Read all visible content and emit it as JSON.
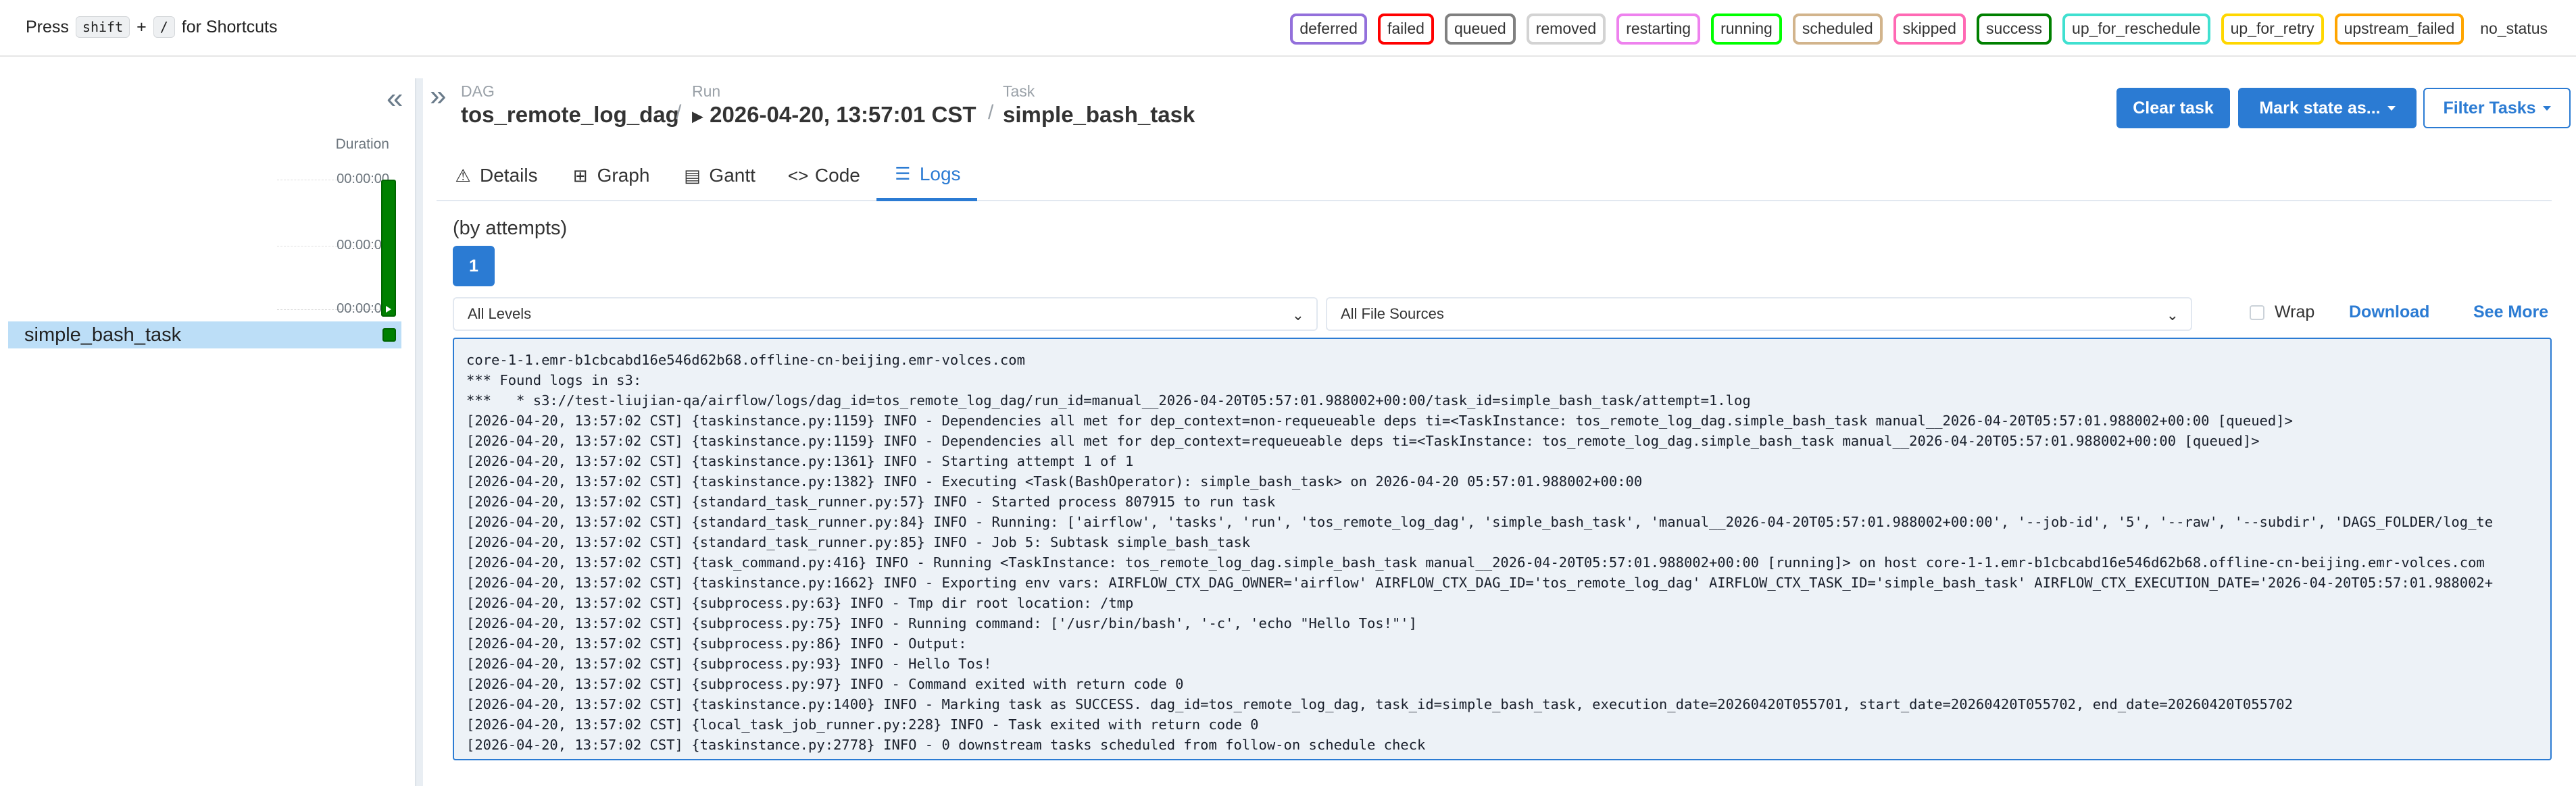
{
  "topbar": {
    "shortcut_prefix": "Press",
    "shortcut_key1": "shift",
    "shortcut_plus": "+",
    "shortcut_key2": "/",
    "shortcut_suffix": "for Shortcuts",
    "states": [
      {
        "label": "deferred",
        "color": "#9370DB"
      },
      {
        "label": "failed",
        "color": "#FF0000"
      },
      {
        "label": "queued",
        "color": "#808080"
      },
      {
        "label": "removed",
        "color": "#D3D3D3"
      },
      {
        "label": "restarting",
        "color": "#EE82EE"
      },
      {
        "label": "running",
        "color": "#00FF00"
      },
      {
        "label": "scheduled",
        "color": "#D2B48C"
      },
      {
        "label": "skipped",
        "color": "#FF69B4"
      },
      {
        "label": "success",
        "color": "#008000"
      },
      {
        "label": "up_for_reschedule",
        "color": "#40E0D0"
      },
      {
        "label": "up_for_retry",
        "color": "#FFD700"
      },
      {
        "label": "upstream_failed",
        "color": "#FFA500"
      }
    ],
    "no_status": "no_status"
  },
  "grid": {
    "duration_label": "Duration",
    "ticks": [
      "00:00:00",
      "00:00:00",
      "00:00:00"
    ],
    "task_name": "simple_bash_task",
    "run_state_color": "#008000",
    "collapse_icon": "double-chevron-left-icon",
    "expand_icon": "double-chevron-right-icon"
  },
  "header": {
    "dag_label": "DAG",
    "dag_value": "tos_remote_log_dag",
    "run_label": "Run",
    "run_value": "2026-04-20, 13:57:01 CST",
    "task_label": "Task",
    "task_value": "simple_bash_task",
    "separator": "/",
    "clear_task": "Clear task",
    "mark_state": "Mark state as...",
    "filter_tasks": "Filter Tasks"
  },
  "tabs": [
    {
      "label": "Details",
      "icon": "warning-triangle-icon",
      "glyph": "⚠"
    },
    {
      "label": "Graph",
      "icon": "graph-icon",
      "glyph": "⊞"
    },
    {
      "label": "Gantt",
      "icon": "gantt-icon",
      "glyph": "▤"
    },
    {
      "label": "Code",
      "icon": "code-icon",
      "glyph": "<>"
    },
    {
      "label": "Logs",
      "icon": "logs-icon",
      "glyph": "☰"
    }
  ],
  "active_tab": "Logs",
  "logs": {
    "attempts_label": "(by attempts)",
    "attempt": "1",
    "level_filter": "All Levels",
    "source_filter": "All File Sources",
    "wrap_label": "Wrap",
    "download_label": "Download",
    "see_more_label": "See More",
    "lines": [
      "core-1-1.emr-b1cbcabd16e546d62b68.offline-cn-beijing.emr-volces.com",
      "*** Found logs in s3:",
      "***   * s3://test-liujian-qa/airflow/logs/dag_id=tos_remote_log_dag/run_id=manual__2026-04-20T05:57:01.988002+00:00/task_id=simple_bash_task/attempt=1.log",
      "[2026-04-20, 13:57:02 CST] {taskinstance.py:1159} INFO - Dependencies all met for dep_context=non-requeueable deps ti=<TaskInstance: tos_remote_log_dag.simple_bash_task manual__2026-04-20T05:57:01.988002+00:00 [queued]>",
      "[2026-04-20, 13:57:02 CST] {taskinstance.py:1159} INFO - Dependencies all met for dep_context=requeueable deps ti=<TaskInstance: tos_remote_log_dag.simple_bash_task manual__2026-04-20T05:57:01.988002+00:00 [queued]>",
      "[2026-04-20, 13:57:02 CST] {taskinstance.py:1361} INFO - Starting attempt 1 of 1",
      "[2026-04-20, 13:57:02 CST] {taskinstance.py:1382} INFO - Executing <Task(BashOperator): simple_bash_task> on 2026-04-20 05:57:01.988002+00:00",
      "[2026-04-20, 13:57:02 CST] {standard_task_runner.py:57} INFO - Started process 807915 to run task",
      "[2026-04-20, 13:57:02 CST] {standard_task_runner.py:84} INFO - Running: ['airflow', 'tasks', 'run', 'tos_remote_log_dag', 'simple_bash_task', 'manual__2026-04-20T05:57:01.988002+00:00', '--job-id', '5', '--raw', '--subdir', 'DAGS_FOLDER/log_te",
      "[2026-04-20, 13:57:02 CST] {standard_task_runner.py:85} INFO - Job 5: Subtask simple_bash_task",
      "[2026-04-20, 13:57:02 CST] {task_command.py:416} INFO - Running <TaskInstance: tos_remote_log_dag.simple_bash_task manual__2026-04-20T05:57:01.988002+00:00 [running]> on host core-1-1.emr-b1cbcabd16e546d62b68.offline-cn-beijing.emr-volces.com",
      "[2026-04-20, 13:57:02 CST] {taskinstance.py:1662} INFO - Exporting env vars: AIRFLOW_CTX_DAG_OWNER='airflow' AIRFLOW_CTX_DAG_ID='tos_remote_log_dag' AIRFLOW_CTX_TASK_ID='simple_bash_task' AIRFLOW_CTX_EXECUTION_DATE='2026-04-20T05:57:01.988002+",
      "[2026-04-20, 13:57:02 CST] {subprocess.py:63} INFO - Tmp dir root location: /tmp",
      "[2026-04-20, 13:57:02 CST] {subprocess.py:75} INFO - Running command: ['/usr/bin/bash', '-c', 'echo \"Hello Tos!\"']",
      "[2026-04-20, 13:57:02 CST] {subprocess.py:86} INFO - Output:",
      "[2026-04-20, 13:57:02 CST] {subprocess.py:93} INFO - Hello Tos!",
      "[2026-04-20, 13:57:02 CST] {subprocess.py:97} INFO - Command exited with return code 0",
      "[2026-04-20, 13:57:02 CST] {taskinstance.py:1400} INFO - Marking task as SUCCESS. dag_id=tos_remote_log_dag, task_id=simple_bash_task, execution_date=20260420T055701, start_date=20260420T055702, end_date=20260420T055702",
      "[2026-04-20, 13:57:02 CST] {local_task_job_runner.py:228} INFO - Task exited with return code 0",
      "[2026-04-20, 13:57:02 CST] {taskinstance.py:2778} INFO - 0 downstream tasks scheduled from follow-on schedule check"
    ]
  }
}
